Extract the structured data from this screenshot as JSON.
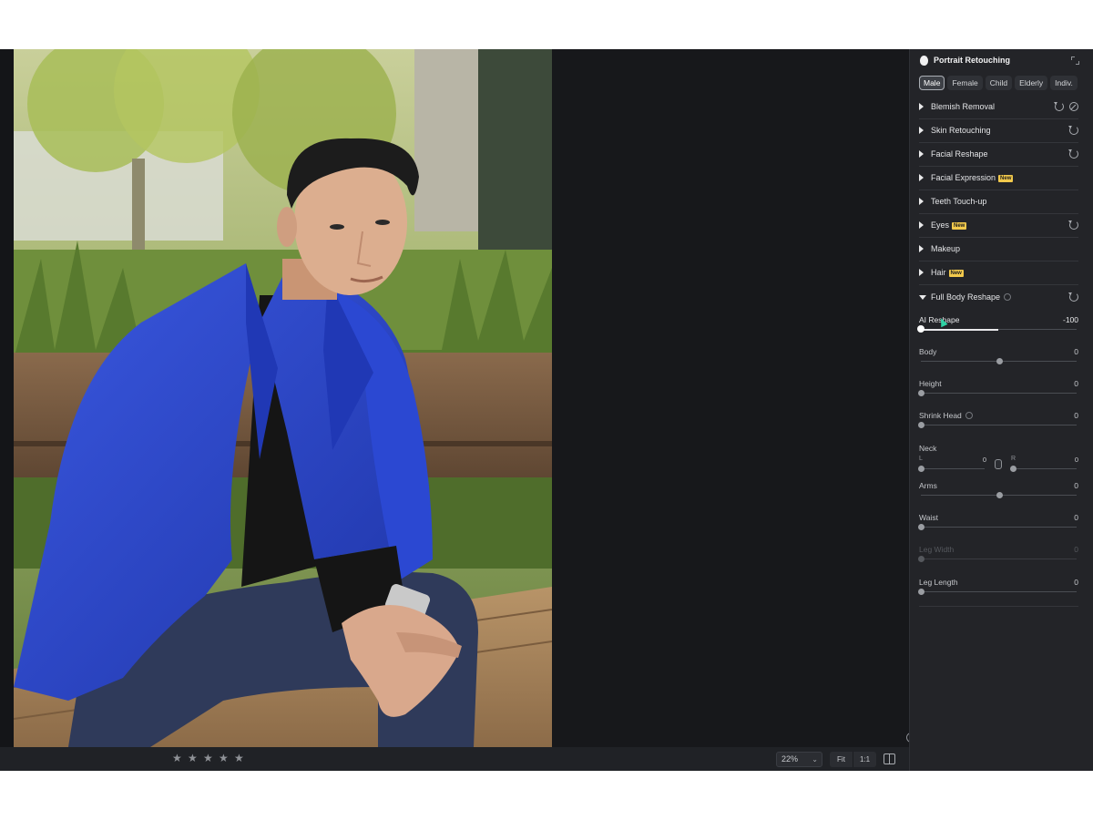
{
  "panel": {
    "title": "Portrait Retouching",
    "tabs": [
      "Male",
      "Female",
      "Child",
      "Elderly",
      "Indiv."
    ],
    "active_tab": "Male",
    "sections": [
      {
        "label": "Blemish Removal",
        "badge": "",
        "expanded": false
      },
      {
        "label": "Skin Retouching",
        "badge": "",
        "expanded": false
      },
      {
        "label": "Facial Reshape",
        "badge": "",
        "expanded": false
      },
      {
        "label": "Facial Expression",
        "badge": "New",
        "expanded": false
      },
      {
        "label": "Teeth Touch-up",
        "badge": "",
        "expanded": false
      },
      {
        "label": "Eyes",
        "badge": "New",
        "expanded": false
      },
      {
        "label": "Makeup",
        "badge": "",
        "expanded": false
      },
      {
        "label": "Hair",
        "badge": "New",
        "expanded": false
      },
      {
        "label": "Full Body Reshape",
        "badge": "",
        "expanded": true
      }
    ],
    "sliders": {
      "ai_reshape": {
        "label": "AI Reshape",
        "value": "-100"
      },
      "body": {
        "label": "Body",
        "value": "0"
      },
      "height": {
        "label": "Height",
        "value": "0"
      },
      "shrink_head": {
        "label": "Shrink Head",
        "value": "0"
      },
      "neck": {
        "label": "Neck",
        "left_label": "L",
        "left_value": "0",
        "right_label": "R",
        "right_value": "0"
      },
      "arms": {
        "label": "Arms",
        "value": "0"
      },
      "waist": {
        "label": "Waist",
        "value": "0"
      },
      "leg_width": {
        "label": "Leg Width",
        "value": "0"
      },
      "leg_length": {
        "label": "Leg Length",
        "value": "0"
      }
    }
  },
  "bottombar": {
    "rating_stars": [
      "★",
      "★",
      "★",
      "★",
      "★"
    ],
    "zoom": "22%",
    "fit": "Fit",
    "one_to_one": "1:1"
  },
  "canvas": {
    "info_glyph": "i"
  },
  "colors": {
    "panel_bg": "#232428",
    "canvas_bg": "#17181b",
    "badge": "#f2c94c",
    "jacket": "#2a46c9",
    "cursor": "#2fd3a5"
  }
}
